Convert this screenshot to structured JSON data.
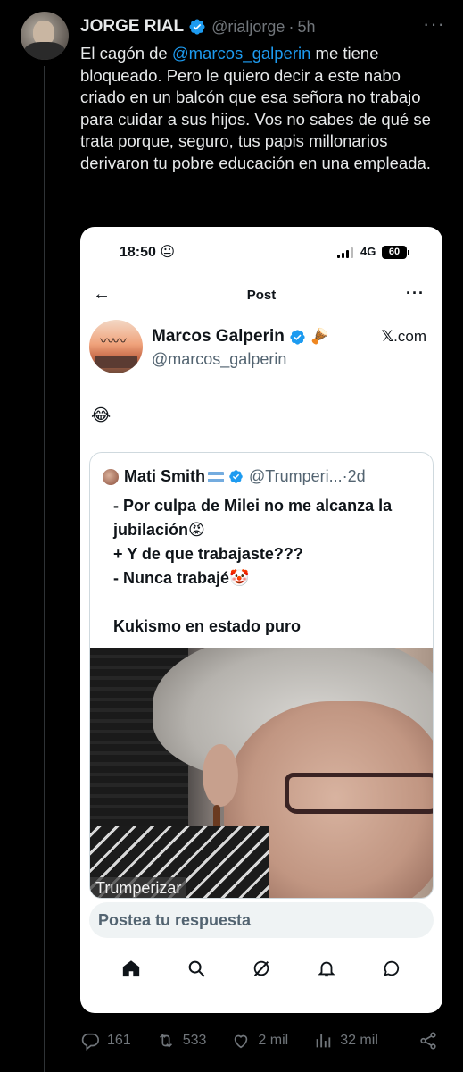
{
  "tweet": {
    "author_name": "JORGE RIAL",
    "author_handle": "@rialjorge",
    "separator": "·",
    "time": "5h",
    "more": "···",
    "text_before": "El cagón de ",
    "mention": "@marcos_galperin",
    "text_after": " me tiene bloqueado. Pero le quiero decir a este nabo criado en un balcón que esa señora no trabajo para cuidar a sus hijos. Vos no sabes de qué se trata porque, seguro, tus papis millonarios derivaron tu pobre educación en una empleada."
  },
  "screenshot": {
    "status_time": "18:50 😐",
    "network": "4G",
    "battery": "60",
    "nav_back": "←",
    "nav_title": "Post",
    "nav_more": "···",
    "post_author": "Marcos Galperin",
    "post_author_emoji": "🪘",
    "post_handle": "@marcos_galperin",
    "x_logo": "𝕏",
    "x_suffix": ".com",
    "post_text": "😂",
    "quote": {
      "author": "Mati Smith",
      "handle": "@Trumperi...",
      "separator": "·",
      "time": "2d",
      "line1": "- Por culpa de Milei no me alcanza la jubilación😡",
      "line2": "+ Y de que trabajaste???",
      "line3": "- Nunca trabajé🤡",
      "line4": "Kukismo en estado puro",
      "video_caption": "Trumperizar"
    },
    "reply_placeholder": "Postea tu respuesta"
  },
  "actions": {
    "replies": "161",
    "reposts": "533",
    "likes": "2 mil",
    "views": "32 mil"
  },
  "colors": {
    "background": "#000000",
    "accent": "#1d9bf0",
    "muted": "#71767b",
    "verified": "#1d9bf0"
  }
}
